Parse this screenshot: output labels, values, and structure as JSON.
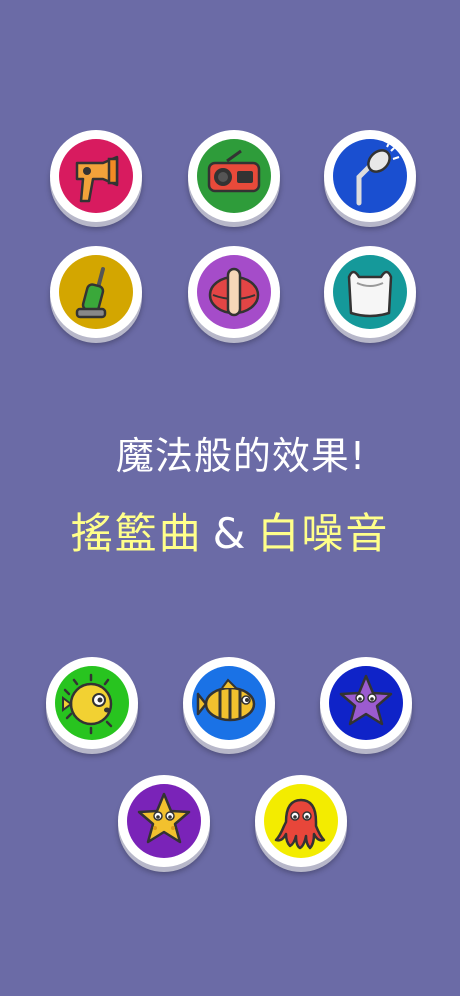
{
  "headline": "魔法般的效果!",
  "subline": {
    "left": "搖籃曲",
    "amp": "&",
    "right": "白噪音"
  },
  "sound_buttons": [
    {
      "icon": "hair-dryer-icon",
      "color": "#d81b5f"
    },
    {
      "icon": "radio-icon",
      "color": "#2e9c3a"
    },
    {
      "icon": "shower-icon",
      "color": "#1a4fd0"
    },
    {
      "icon": "vacuum-cleaner-icon",
      "color": "#d3a600"
    },
    {
      "icon": "shush-mouth-icon",
      "color": "#a54cc9"
    },
    {
      "icon": "plastic-bag-icon",
      "color": "#15999a"
    }
  ],
  "lullaby_buttons": [
    {
      "icon": "pufferfish-icon",
      "color": "#28c41f"
    },
    {
      "icon": "tropical-fish-icon",
      "color": "#1a72e6"
    },
    {
      "icon": "starfish-icon",
      "color": "#0f23c8"
    },
    {
      "icon": "starfish-icon",
      "color": "#7a23b8"
    },
    {
      "icon": "octopus-icon",
      "color": "#f3ec00"
    }
  ]
}
